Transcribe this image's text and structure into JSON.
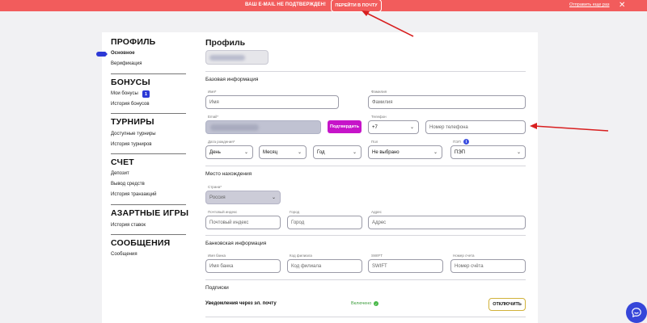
{
  "banner": {
    "message": "ВАШ E-MAIL НЕ ПОДТВЕРЖДЕН!",
    "go_to_mail": "ПЕРЕЙТИ В ПОЧТУ",
    "resend": "Отправить еще раз",
    "close_icon": "close-icon"
  },
  "sidebar": {
    "sections": [
      {
        "title": "ПРОФИЛЬ",
        "items": [
          "Основное",
          "Верификация"
        ]
      },
      {
        "title": "БОНУСЫ",
        "items": [
          "Мои бонусы",
          "История бонусов"
        ],
        "badge": "1"
      },
      {
        "title": "ТУРНИРЫ",
        "items": [
          "Доступные турниры",
          "История турниров"
        ]
      },
      {
        "title": "СЧЕТ",
        "items": [
          "Депозит",
          "Вывод средств",
          "История транзакций"
        ]
      },
      {
        "title": "АЗАРТНЫЕ ИГРЫ",
        "items": [
          "История ставок"
        ]
      },
      {
        "title": "СООБЩЕНИЯ",
        "items": [
          "Сообщения"
        ]
      }
    ],
    "active_item": "Основное"
  },
  "main": {
    "title": "Профиль",
    "basic": {
      "title": "Базовая информация",
      "first_name_label": "Имя*",
      "first_name_placeholder": "Имя",
      "last_name_label": "Фамилия",
      "last_name_placeholder": "Фамилия",
      "email_label": "Email*",
      "confirm_button": "Подтвердить",
      "phone_label": "Телефон",
      "phone_code": "+7",
      "phone_placeholder": "Номер телефона",
      "dob_label": "Дата рождения*",
      "day": "День",
      "month": "Месяц",
      "year": "Год",
      "gender_label": "Пол",
      "gender_value": "Не выбрано",
      "odds_label": "ПЭП",
      "odds_value": "ПЭП"
    },
    "location": {
      "title": "Место нахождения",
      "country_label": "Страна*",
      "country_value": "Россия",
      "zip_label": "Почтовый индекс",
      "zip_placeholder": "Почтовый индекс",
      "city_label": "Город",
      "city_placeholder": "Город",
      "address_label": "Адрес",
      "address_placeholder": "Адрес"
    },
    "bank": {
      "title": "Банковская информация",
      "bank_name_label": "Имя банка",
      "bank_name_placeholder": "Имя банка",
      "branch_label": "Код филиала",
      "branch_placeholder": "Код филиала",
      "swift_label": "SWIFT",
      "swift_placeholder": "SWIFT",
      "account_label": "Номер счета",
      "account_placeholder": "Номер счёта"
    },
    "subscriptions": {
      "title": "Подписки",
      "email_notifications": "Уведомления через эл. почту",
      "status": "Включено",
      "disable_button": "ОТКЛЮЧИТЬ"
    }
  },
  "colors": {
    "banner": "#f25c5c",
    "accent_blue": "#2c39d6",
    "confirm_purple": "#c614c9",
    "annotation_red": "#d81f1f"
  }
}
